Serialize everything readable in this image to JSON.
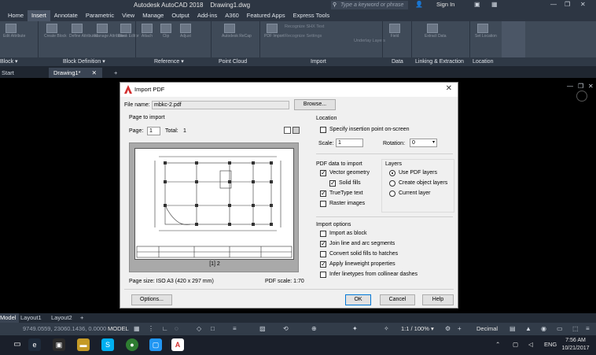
{
  "app": {
    "title": "Autodesk AutoCAD 2018    Drawing1.dwg",
    "search_placeholder": "Type a keyword or phrase",
    "signin": "Sign In"
  },
  "ribbon_tabs": [
    "Home",
    "Insert",
    "Annotate",
    "Parametric",
    "View",
    "Manage",
    "Output",
    "Add-ins",
    "A360",
    "Featured Apps",
    "Express Tools"
  ],
  "active_tab": "Insert",
  "ribbon_panels": [
    "Block ▾",
    "Block Definition ▾",
    "Reference ▾",
    "Point Cloud",
    "Import",
    "Data",
    "Linking & Extraction",
    "Location"
  ],
  "ribbon_buttons": [
    "Edit Attribute",
    "Create Block",
    "Define Attributes",
    "Manage Attributes",
    "Block Editor",
    "Attach",
    "Clip",
    "Adjust",
    "Autodesk ReCap",
    "PDF Import",
    "Field",
    "Extract Data",
    "Set Location"
  ],
  "ribbon_small": [
    "Recognize SHX Text",
    "Recognize Settings",
    "Underlay Layers"
  ],
  "file_tabs": [
    "Start",
    "Drawing1*",
    "+"
  ],
  "dialog": {
    "title": "Import PDF",
    "file_name_label": "File name:",
    "file_name_value": "mbkc-2.pdf",
    "browse": "Browse...",
    "page_to_import": "Page to import",
    "page_label": "Page:",
    "page_value": "1",
    "total_label": "Total:",
    "total_value": "1",
    "preview_caption": "[1] 2",
    "page_size": "Page size: ISO A3 (420 x 297 mm)",
    "pdf_scale": "PDF scale: 1:70",
    "location": "Location",
    "specify_insertion": "Specify insertion point on-screen",
    "scale_label": "Scale:",
    "scale_value": "1",
    "rotation_label": "Rotation:",
    "rotation_value": "0",
    "pdf_data": "PDF data to import",
    "vector_geometry": "Vector geometry",
    "solid_fills": "Solid fills",
    "truetype_text": "TrueType text",
    "raster_images": "Raster images",
    "layers": "Layers",
    "use_pdf_layers": "Use PDF layers",
    "create_object_layer": "Create object layers",
    "current_layer": "Current layer",
    "import_options": "Import options",
    "import_as_block": "Import as block",
    "join_segments": "Join line and arc segments",
    "convert_fills": "Convert solid fills to hatches",
    "apply_lineweight": "Apply lineweight properties",
    "infer_linetypes": "Infer linetypes from collinear dashes",
    "options": "Options...",
    "ok": "OK",
    "cancel": "Cancel",
    "help": "Help"
  },
  "layout_tabs": [
    "Model",
    "Layout1",
    "Layout2",
    "+"
  ],
  "status": {
    "coords": "9749.0559, 23060.1436, 0.0000",
    "model": "MODEL",
    "annotation_scale": "1:1 / 100% ▾",
    "units": "Decimal"
  },
  "taskbar": {
    "lang": "ENG",
    "time": "7:56 AM",
    "date": "10/21/2017"
  },
  "colors": {
    "accent": "#0078d7",
    "autocad_red": "#d32f2f",
    "ribbon_bg": "#3f4a58"
  }
}
